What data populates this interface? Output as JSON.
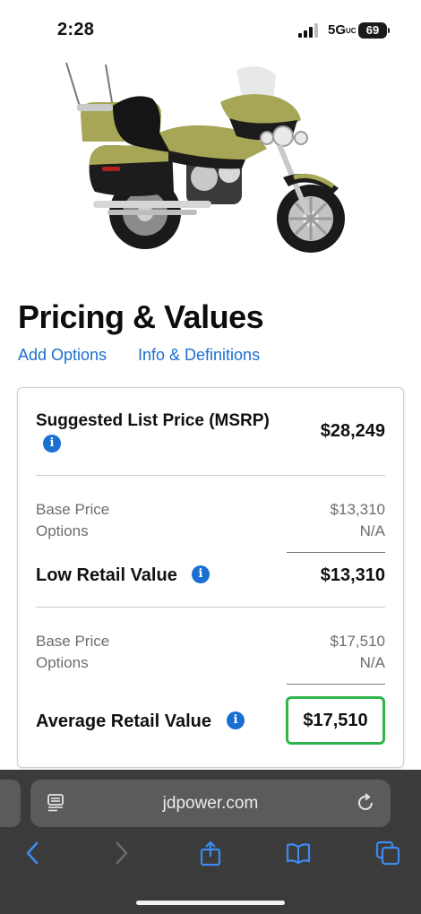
{
  "status_bar": {
    "time": "2:28",
    "network": "5G",
    "network_suffix": "UC",
    "battery": "69"
  },
  "hero": {
    "icon": "motorcycle-image",
    "colors": {
      "body": "#a6a656",
      "trim": "#1c1c1c",
      "chrome": "#c9c9c9"
    }
  },
  "page": {
    "title": "Pricing & Values",
    "links": {
      "add_options": "Add Options",
      "info_definitions": "Info & Definitions"
    }
  },
  "pricing": {
    "msrp": {
      "label": "Suggested List Price (MSRP)",
      "value": "$28,249"
    },
    "low_retail": {
      "base_label": "Base Price",
      "base_value": "$13,310",
      "options_label": "Options",
      "options_value": "N/A",
      "title": "Low Retail Value",
      "value": "$13,310"
    },
    "average_retail": {
      "base_label": "Base Price",
      "base_value": "$17,510",
      "options_label": "Options",
      "options_value": "N/A",
      "title": "Average Retail Value",
      "value": "$17,510",
      "highlight_color": "#2fb54a"
    }
  },
  "browser": {
    "url": "jdpower.com",
    "icons": [
      "reader-icon",
      "reload-icon",
      "back-icon",
      "forward-icon",
      "share-icon",
      "bookmarks-icon",
      "tabs-icon"
    ],
    "accent": "#1a6fd1"
  }
}
